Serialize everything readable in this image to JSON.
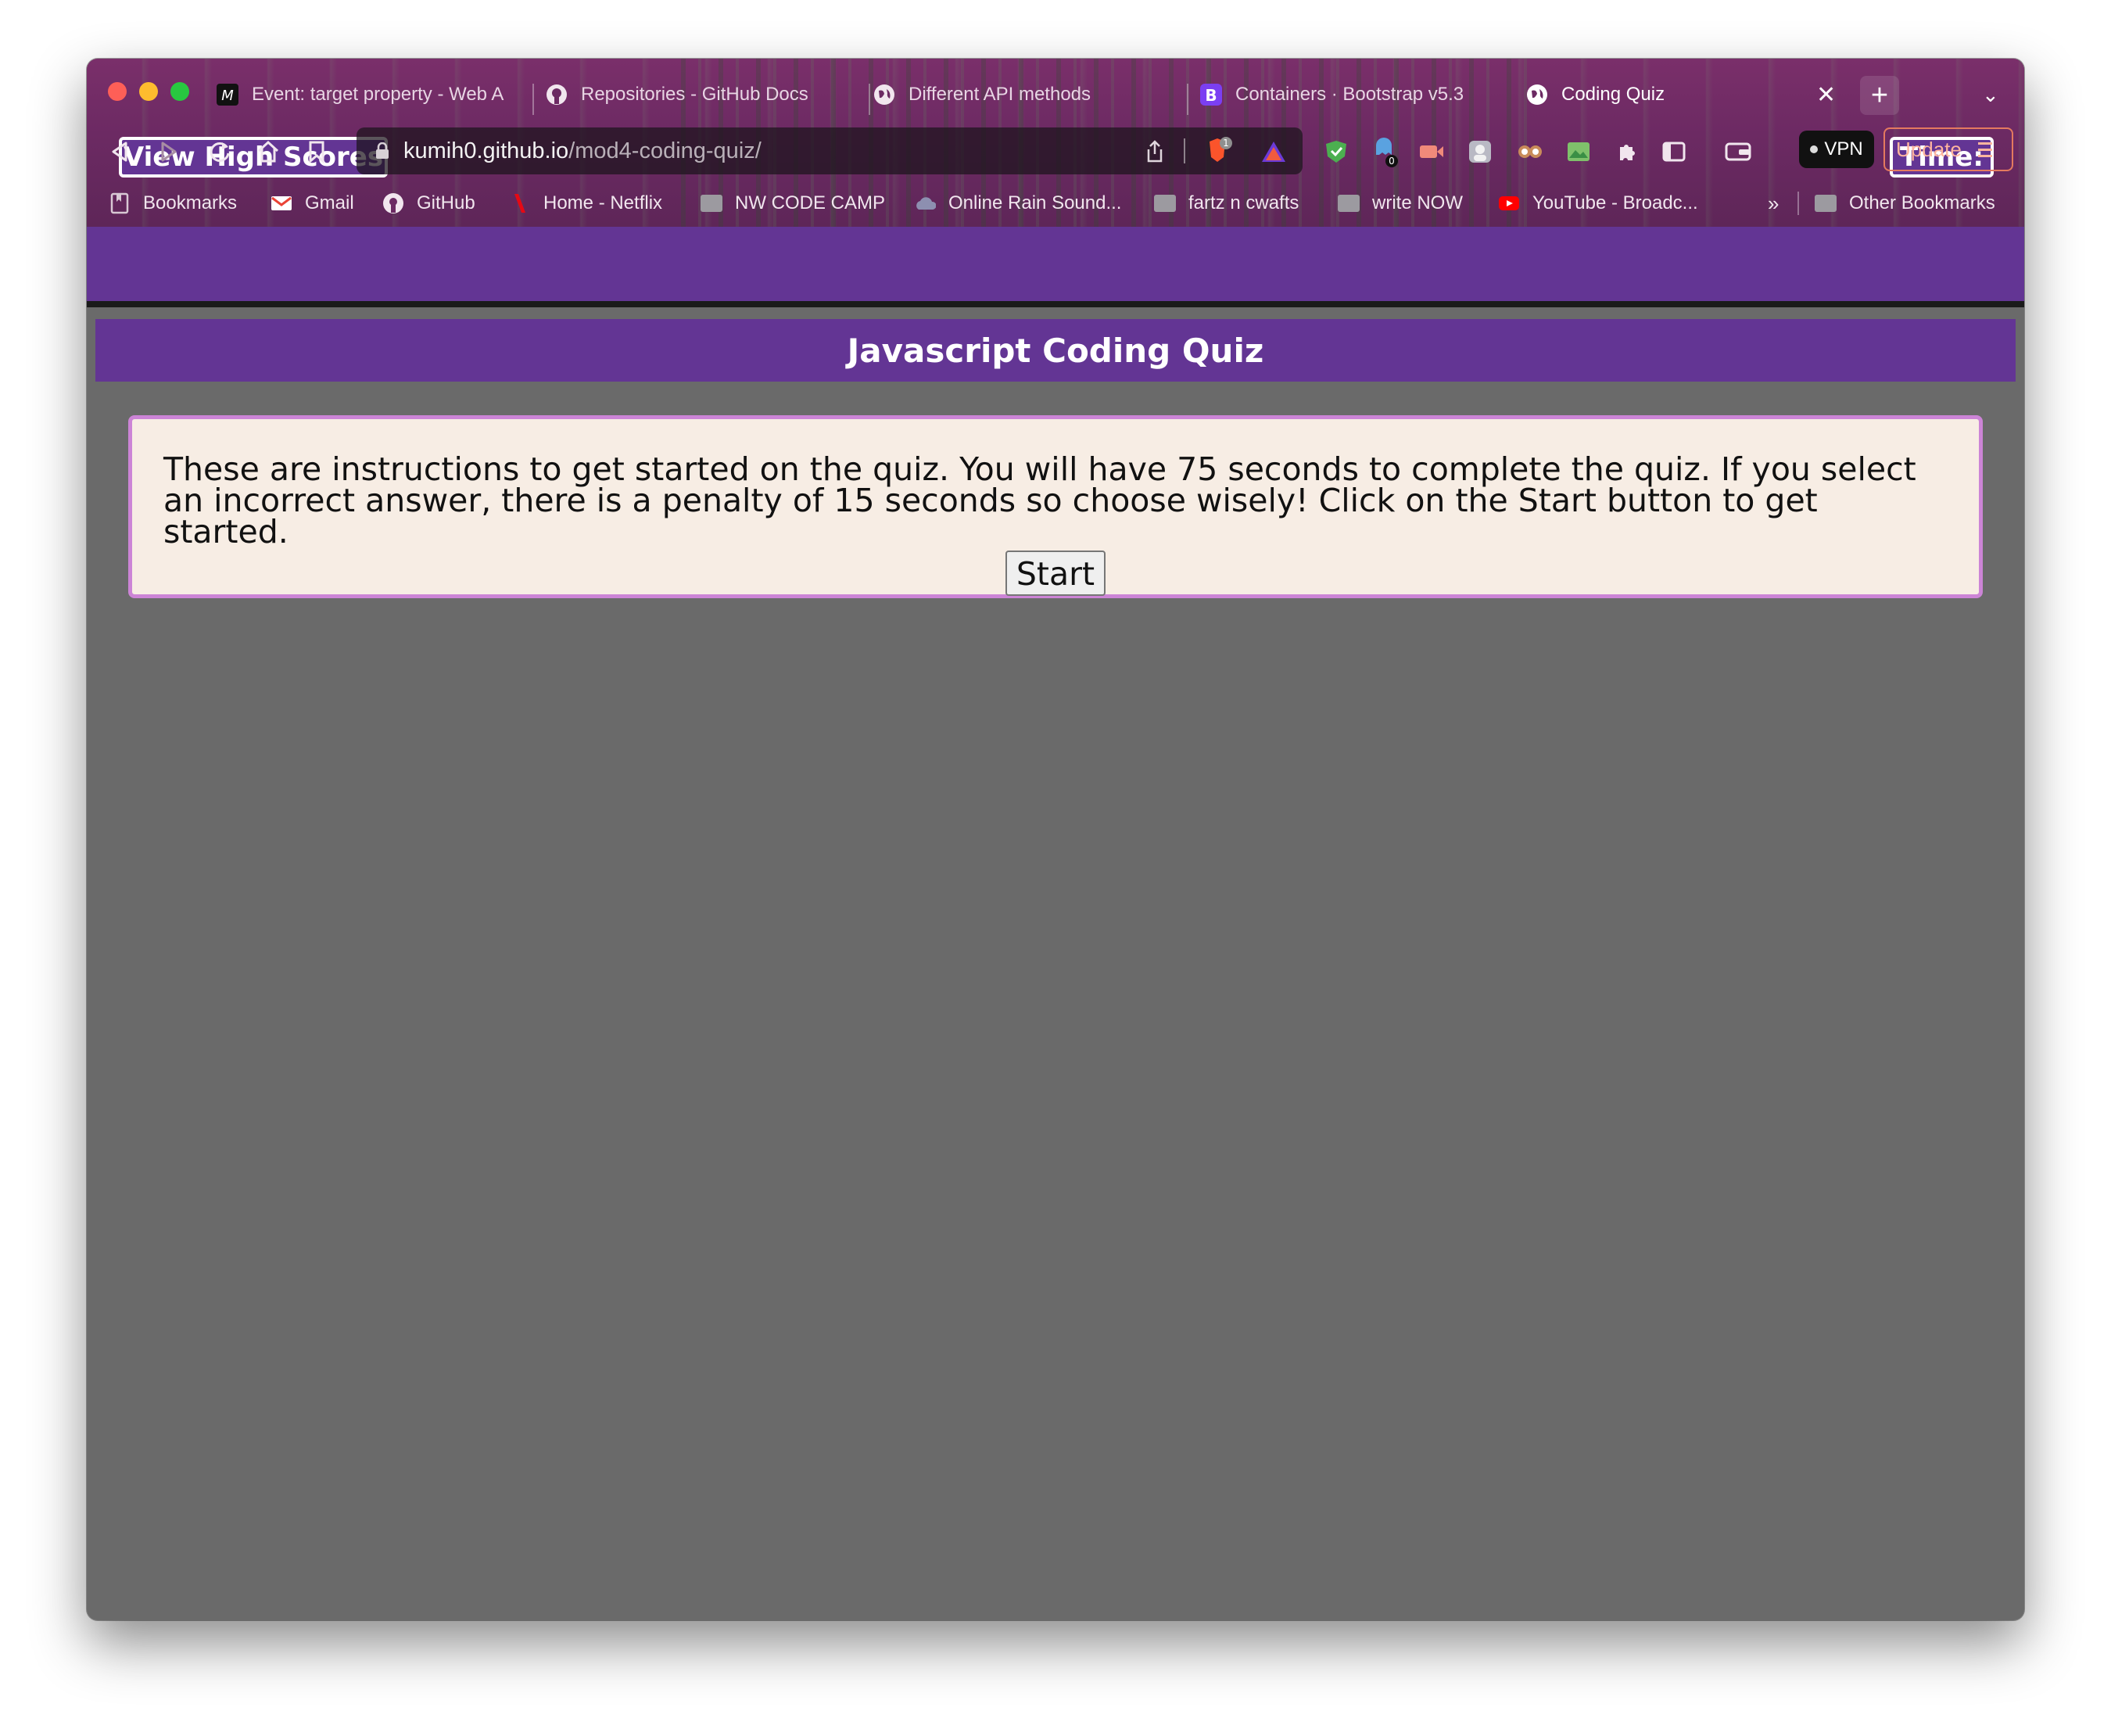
{
  "browser": {
    "tabs": [
      {
        "title": "Event: target property - Web A",
        "icon": "mdn-icon",
        "active": false
      },
      {
        "title": "Repositories - GitHub Docs",
        "icon": "github-icon",
        "active": false
      },
      {
        "title": "Different API methods",
        "icon": "globe-icon",
        "active": false
      },
      {
        "title": "Containers · Bootstrap v5.3",
        "icon": "bootstrap-icon",
        "active": false
      },
      {
        "title": "Coding Quiz",
        "icon": "globe-icon",
        "active": true
      }
    ],
    "url_host": "kumih0.github.io",
    "url_path": "/mod4-coding-quiz/",
    "shield_count": "1",
    "extension_badge": "0",
    "vpn_label": "VPN",
    "update_label": "Update",
    "bookmarks": [
      {
        "label": "Bookmarks",
        "icon": "bookmarks-icon"
      },
      {
        "label": "Gmail",
        "icon": "gmail-icon"
      },
      {
        "label": "GitHub",
        "icon": "github-icon"
      },
      {
        "label": "Home - Netflix",
        "icon": "netflix-icon"
      },
      {
        "label": "NW CODE CAMP",
        "icon": "folder-icon"
      },
      {
        "label": "Online Rain Sound...",
        "icon": "cloud-icon"
      },
      {
        "label": "fartz n cwafts",
        "icon": "folder-icon"
      },
      {
        "label": "write NOW",
        "icon": "folder-icon"
      },
      {
        "label": "YouTube - Broadc...",
        "icon": "youtube-icon"
      },
      {
        "label": "Other Bookmarks",
        "icon": "folder-icon"
      }
    ],
    "bookmarks_overflow": "»"
  },
  "page": {
    "high_scores_label": "View High Scores",
    "time_label": "Time:",
    "title": "Javascript Coding Quiz",
    "instructions": "These are instructions to get started on the quiz. You will have 75 seconds to complete the quiz. If you select an incorrect answer, there is a penalty of 15 seconds so choose wisely! Click on the Start button to get started.",
    "start_label": "Start"
  },
  "colors": {
    "header_purple": "#633594",
    "card_background": "#f7ede4",
    "card_border": "#cc84d6",
    "page_background": "#6a6a6a"
  }
}
